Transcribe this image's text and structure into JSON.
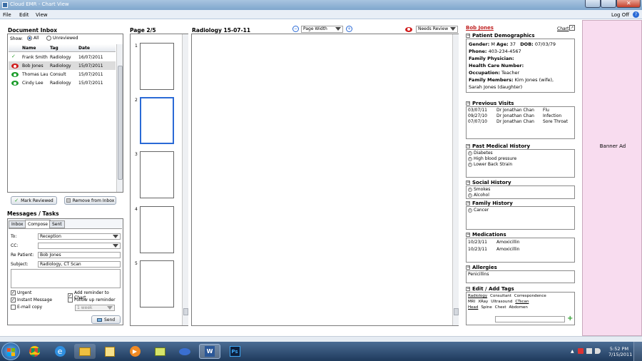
{
  "window": {
    "title": "Cloud EMR - Chart View"
  },
  "menu": {
    "file": "File",
    "edit": "Edit",
    "view": "View",
    "logoff": "Log Off",
    "help": "?"
  },
  "inbox": {
    "title": "Document Inbox",
    "show_label": "Show:",
    "filter_all": "All",
    "filter_unreviewed": "Unreviewed",
    "columns": {
      "name": "Name",
      "tag": "Tag",
      "date": "Date"
    },
    "rows": [
      {
        "name": "Frank Smith",
        "tag": "Radiology",
        "date": "16/07/2011",
        "status": "check"
      },
      {
        "name": "Bob Jones",
        "tag": "Radiology",
        "date": "15/07/2011",
        "status": "red-eye"
      },
      {
        "name": "Thomas Lau",
        "tag": "Consult",
        "date": "15/07/2011",
        "status": "green-eye"
      },
      {
        "name": "Cindy Lee",
        "tag": "Radiology",
        "date": "15/07/2011",
        "status": "green-eye"
      }
    ],
    "mark_reviewed": "Mark Reviewed",
    "remove": "Remove from Inbox"
  },
  "messages": {
    "title": "Messages / Tasks",
    "tabs": [
      "Inbox",
      "Compose",
      "Sent"
    ],
    "to_label": "To:",
    "to_value": "Reception",
    "cc_label": "CC:",
    "cc_value": "",
    "repatient_label": "Re Patient:",
    "repatient_value": "Bob Jones",
    "subject_label": "Subject:",
    "subject_value": "Radiology, CT Scan",
    "urgent": "Urgent",
    "instant": "Instant Message",
    "email": "E-mail copy",
    "add_reminder": "Add reminder to Chart",
    "followup": "Follow up reminder",
    "followup_period": "1 week",
    "send": "Send"
  },
  "pages": {
    "title": "Page 2/5",
    "numbers": [
      "1",
      "2",
      "3",
      "4",
      "5"
    ]
  },
  "viewer": {
    "title": "Radiology 15-07-11",
    "zoom": "Page Width",
    "review_status": "Needs Review"
  },
  "patient": {
    "name": "Bob Jones",
    "chart_link": "Chart",
    "demographics_title": "Patient Demographics",
    "gender_label": "Gender:",
    "gender": "M",
    "age_label": "Age:",
    "age": "37",
    "dob_label": "DOB:",
    "dob": "07/03/79",
    "phone_label": "Phone:",
    "phone": "403-234-4567",
    "physician_label": "Family Physician:",
    "hcn_label": "Health Care Number:",
    "occupation_label": "Occupation:",
    "occupation": "Teacher",
    "family_label": "Family Members:",
    "family_1": "Kim Jones (wife),",
    "family_2": "Sarah Jones (daughter)",
    "visits_title": "Previous Visits",
    "visits": [
      {
        "date": "03/07/11",
        "doctor": "Dr Jonathan Chan",
        "reason": "Flu"
      },
      {
        "date": "09/27/10",
        "doctor": "Dr Jonathan Chan",
        "reason": "Infection"
      },
      {
        "date": "07/07/10",
        "doctor": "Dr Jonathan Chan",
        "reason": "Sore Throat"
      }
    ],
    "pmh_title": "Past Medical History",
    "pmh": [
      "Diabetes",
      "High blood pressure",
      "Lower Back Strain"
    ],
    "social_title": "Social History",
    "social": [
      "Smokes",
      "Alcohol"
    ],
    "family_hist_title": "Family History",
    "family_hist": [
      "Cancer"
    ],
    "meds_title": "Medications",
    "meds": [
      {
        "date": "10/23/11",
        "name": "Amoxicillin"
      },
      {
        "date": "10/23/11",
        "name": "Amoxicillin"
      }
    ],
    "allergies_title": "Allergies",
    "allergies": "Penicillins",
    "tags_title": "Edit / Add Tags",
    "tags_row1": [
      "Radiology",
      "Consultant",
      "Correspondence"
    ],
    "tags_row2": [
      "MRI",
      "XRay",
      "Ultrasound",
      "CTscan"
    ],
    "tags_row3": [
      "Head",
      "Spine",
      "Chest",
      "Abdomen"
    ]
  },
  "banner": {
    "text": "Banner Ad"
  },
  "taskbar": {
    "time": "5:52 PM",
    "date": "7/15/2011"
  }
}
